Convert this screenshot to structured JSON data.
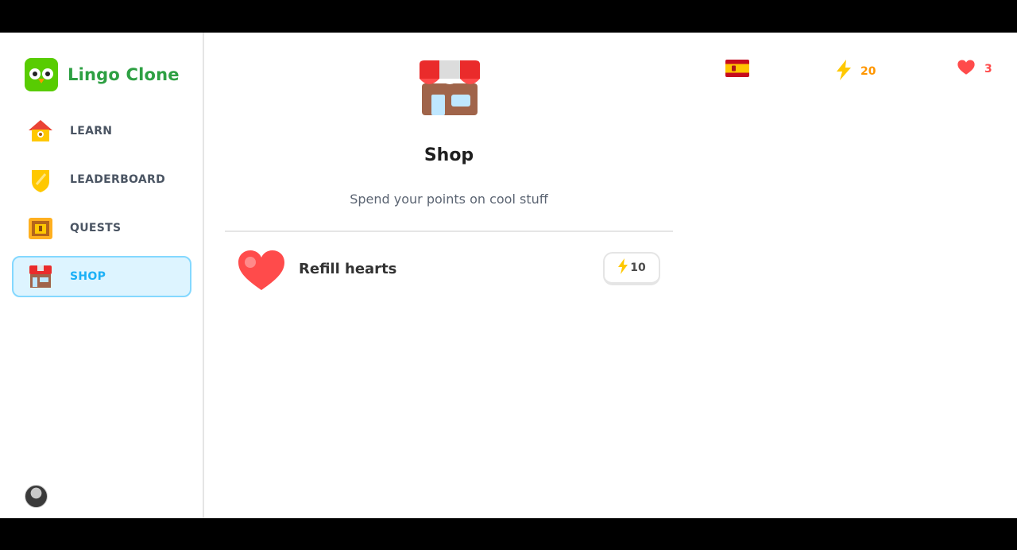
{
  "app": {
    "name": "Lingo Clone"
  },
  "sidebar": {
    "items": [
      {
        "label": "LEARN",
        "icon": "house-icon",
        "active": false
      },
      {
        "label": "LEADERBOARD",
        "icon": "shield-icon",
        "active": false
      },
      {
        "label": "QUESTS",
        "icon": "chest-icon",
        "active": false
      },
      {
        "label": "SHOP",
        "icon": "shop-icon",
        "active": true
      }
    ]
  },
  "header": {
    "flag": "spain-flag-icon",
    "points": "20",
    "hearts": "3"
  },
  "shop": {
    "title": "Shop",
    "subtitle": "Spend your points on cool stuff",
    "items": [
      {
        "label": "Refill hearts",
        "cost": "10",
        "icon": "heart-icon"
      }
    ]
  },
  "colors": {
    "brand_green": "#2ea043",
    "active_blue": "#1cb0f6",
    "points_orange": "#ff9600",
    "hearts_red": "#ff4b4b"
  }
}
